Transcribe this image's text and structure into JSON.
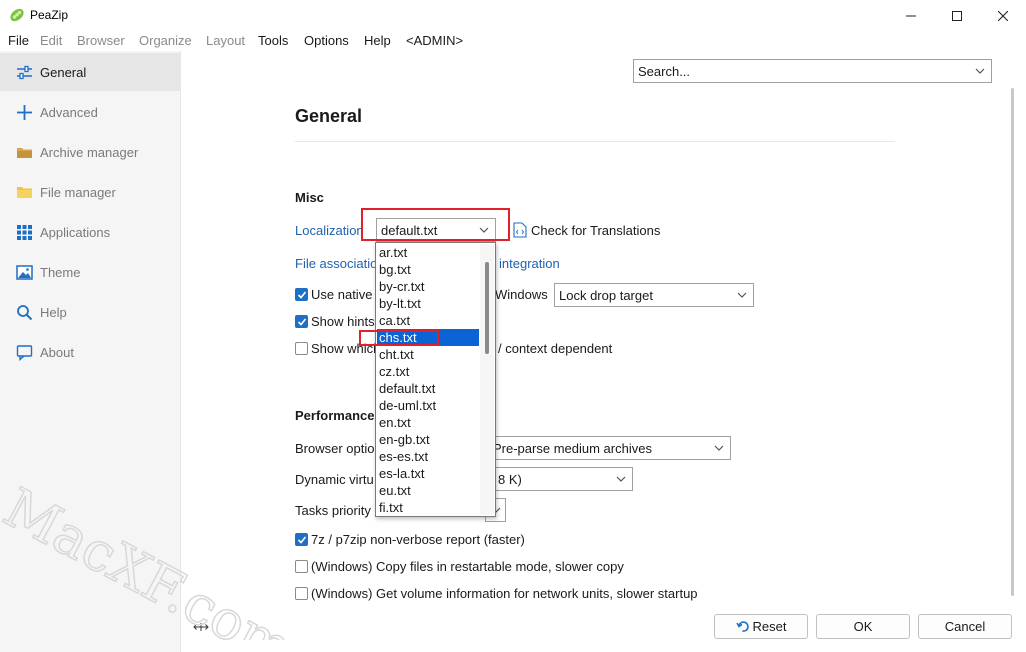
{
  "window": {
    "title": "PeaZip"
  },
  "menu": [
    "File",
    "Edit",
    "Browser",
    "Organize",
    "Layout",
    "Tools",
    "Options",
    "Help",
    "<ADMIN>"
  ],
  "sidebar": {
    "items": [
      {
        "label": "General",
        "icon": "sliders-icon"
      },
      {
        "label": "Advanced",
        "icon": "plus-icon"
      },
      {
        "label": "Archive manager",
        "icon": "archive-folder-icon"
      },
      {
        "label": "File manager",
        "icon": "folder-icon"
      },
      {
        "label": "Applications",
        "icon": "grid-icon"
      },
      {
        "label": "Theme",
        "icon": "image-icon"
      },
      {
        "label": "Help",
        "icon": "search-icon"
      },
      {
        "label": "About",
        "icon": "chat-icon"
      }
    ]
  },
  "search": {
    "value": "Search..."
  },
  "page": {
    "heading": "General"
  },
  "misc": {
    "section": "Misc",
    "localization_label": "Localization",
    "localization_value": "default.txt",
    "check_translations": "Check for Translations",
    "file_associations": "File associatio",
    "integration": "integration",
    "use_native": "Use native",
    "windows": "Windows",
    "lock_drop_target": "Lock drop target",
    "show_hints": "Show hints",
    "show_which": "Show which",
    "context_dependent": "/ context dependent"
  },
  "dropdown": {
    "items": [
      "ar.txt",
      "bg.txt",
      "by-cr.txt",
      "by-lt.txt",
      "ca.txt",
      "chs.txt",
      "cht.txt",
      "cz.txt",
      "default.txt",
      "de-uml.txt",
      "en.txt",
      "en-gb.txt",
      "es-es.txt",
      "es-la.txt",
      "eu.txt",
      "fi.txt"
    ],
    "selected": "chs.txt"
  },
  "performance": {
    "section": "Performances",
    "browser_options": "Browser optio",
    "browser_value": "Pre-parse medium archives",
    "dynamic_virtual": "Dynamic virtu",
    "dynamic_value": "8 K)",
    "tasks_priority": "Tasks priority",
    "nonverbose": "7z / p7zip non-verbose report (faster)",
    "restartable": "(Windows) Copy files in restartable mode, slower copy",
    "volume_info": "(Windows) Get volume information for network units, slower startup"
  },
  "buttons": {
    "reset": "Reset",
    "ok": "OK",
    "cancel": "Cancel"
  },
  "watermark": "MacXF.com",
  "colors": {
    "accent": "#1f6fc5",
    "link": "#1e62b0",
    "highlight": "#e0202b",
    "selection": "#0a64d3"
  }
}
